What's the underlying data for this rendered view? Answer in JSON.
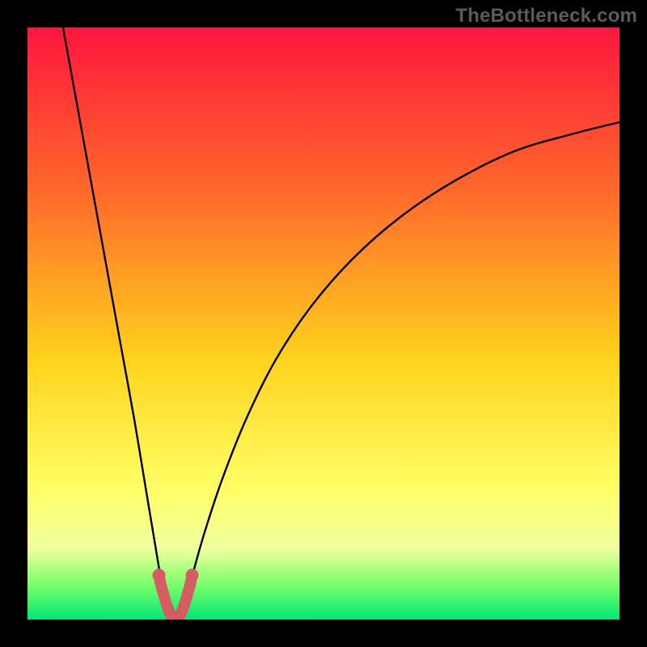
{
  "watermark": "TheBottleneck.com",
  "colors": {
    "frame": "#000000",
    "gradient_top": "#ff163e",
    "gradient_mid1": "#ff6a2b",
    "gradient_mid2": "#ffd21c",
    "gradient_mid3": "#ffff66",
    "gradient_low": "#f0ff9e",
    "gradient_green1": "#7bff6b",
    "gradient_green2": "#00e874",
    "curve": "#000000",
    "curve_marker": "#d65b63"
  },
  "chart_data": {
    "type": "line",
    "title": "",
    "xlabel": "",
    "ylabel": "",
    "xlim": [
      0,
      100
    ],
    "ylim": [
      0,
      100
    ],
    "x_optimum": 25,
    "series": [
      {
        "name": "bottleneck-curve",
        "points": [
          {
            "x": 6,
            "y": 100
          },
          {
            "x": 8,
            "y": 89
          },
          {
            "x": 10,
            "y": 78
          },
          {
            "x": 12,
            "y": 67
          },
          {
            "x": 14,
            "y": 56
          },
          {
            "x": 16,
            "y": 45
          },
          {
            "x": 18,
            "y": 34
          },
          {
            "x": 20,
            "y": 22
          },
          {
            "x": 22,
            "y": 10
          },
          {
            "x": 23,
            "y": 4
          },
          {
            "x": 24,
            "y": 1
          },
          {
            "x": 25,
            "y": 0
          },
          {
            "x": 26,
            "y": 1
          },
          {
            "x": 27,
            "y": 4
          },
          {
            "x": 28,
            "y": 8
          },
          {
            "x": 30,
            "y": 15
          },
          {
            "x": 33,
            "y": 24
          },
          {
            "x": 37,
            "y": 34
          },
          {
            "x": 42,
            "y": 44
          },
          {
            "x": 48,
            "y": 53
          },
          {
            "x": 55,
            "y": 61
          },
          {
            "x": 63,
            "y": 68
          },
          {
            "x": 72,
            "y": 74
          },
          {
            "x": 82,
            "y": 79
          },
          {
            "x": 92,
            "y": 82
          },
          {
            "x": 100,
            "y": 84
          }
        ]
      },
      {
        "name": "bottom-marker-lobe",
        "points": [
          {
            "x": 22.2,
            "y": 7.5
          },
          {
            "x": 22.5,
            "y": 6.0
          },
          {
            "x": 23.0,
            "y": 4.2
          },
          {
            "x": 23.5,
            "y": 2.5
          },
          {
            "x": 24.0,
            "y": 1.2
          },
          {
            "x": 24.5,
            "y": 0.4
          },
          {
            "x": 25.0,
            "y": 0.1
          },
          {
            "x": 25.5,
            "y": 0.4
          },
          {
            "x": 26.0,
            "y": 1.2
          },
          {
            "x": 26.5,
            "y": 2.5
          },
          {
            "x": 27.0,
            "y": 4.2
          },
          {
            "x": 27.5,
            "y": 6.0
          },
          {
            "x": 27.8,
            "y": 7.5
          }
        ]
      }
    ]
  }
}
